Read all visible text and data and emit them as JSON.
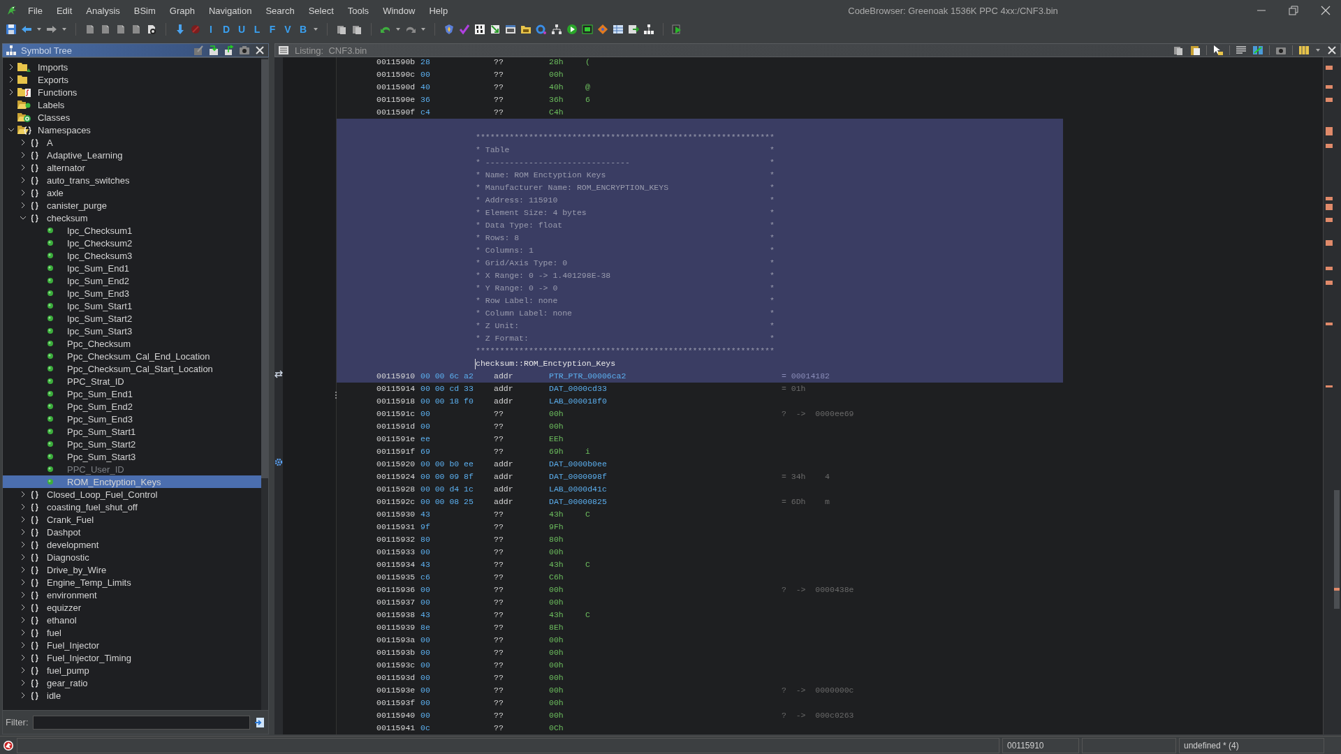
{
  "window": {
    "title": "CodeBrowser: Greenoak 1536K PPC 4xx:/CNF3.bin"
  },
  "menu": [
    "File",
    "Edit",
    "Analysis",
    "BSim",
    "Graph",
    "Navigation",
    "Search",
    "Select",
    "Tools",
    "Window",
    "Help"
  ],
  "toolbar": {
    "letter_buttons": [
      "I",
      "D",
      "U",
      "L",
      "F",
      "V",
      "B"
    ]
  },
  "symbol_tree": {
    "title": "Symbol Tree",
    "items": [
      {
        "label": "Imports",
        "kind": "imports",
        "expanded": false,
        "selected": false
      },
      {
        "label": "Exports",
        "kind": "exports",
        "expanded": false,
        "selected": false
      },
      {
        "label": "Functions",
        "kind": "functions",
        "expanded": false,
        "selected": false
      },
      {
        "label": "Labels",
        "kind": "labels",
        "selected": false
      },
      {
        "label": "Classes",
        "kind": "classes",
        "selected": false
      },
      {
        "label": "Namespaces",
        "kind": "namespaces",
        "expanded": true,
        "selected": false,
        "children": [
          {
            "label": "A",
            "kind": "namespace",
            "expanded": false,
            "selected": false
          },
          {
            "label": "Adaptive_Learning",
            "kind": "namespace",
            "expanded": false,
            "selected": false
          },
          {
            "label": "alternator",
            "kind": "namespace",
            "expanded": false,
            "selected": false
          },
          {
            "label": "auto_trans_switches",
            "kind": "namespace",
            "expanded": false,
            "selected": false
          },
          {
            "label": "axle",
            "kind": "namespace",
            "expanded": false,
            "selected": false
          },
          {
            "label": "canister_purge",
            "kind": "namespace",
            "expanded": false,
            "selected": false
          },
          {
            "label": "checksum",
            "kind": "namespace",
            "expanded": true,
            "selected": false,
            "children": [
              {
                "label": "Ipc_Checksum1",
                "kind": "label",
                "dimmed": false,
                "selected": false
              },
              {
                "label": "Ipc_Checksum2",
                "kind": "label",
                "dimmed": false,
                "selected": false
              },
              {
                "label": "Ipc_Checksum3",
                "kind": "label",
                "dimmed": false,
                "selected": false
              },
              {
                "label": "Ipc_Sum_End1",
                "kind": "label",
                "dimmed": false,
                "selected": false
              },
              {
                "label": "Ipc_Sum_End2",
                "kind": "label",
                "dimmed": false,
                "selected": false
              },
              {
                "label": "Ipc_Sum_End3",
                "kind": "label",
                "dimmed": false,
                "selected": false
              },
              {
                "label": "Ipc_Sum_Start1",
                "kind": "label",
                "dimmed": false,
                "selected": false
              },
              {
                "label": "Ipc_Sum_Start2",
                "kind": "label",
                "dimmed": false,
                "selected": false
              },
              {
                "label": "Ipc_Sum_Start3",
                "kind": "label",
                "dimmed": false,
                "selected": false
              },
              {
                "label": "Ppc_Checksum",
                "kind": "label",
                "dimmed": false,
                "selected": false
              },
              {
                "label": "Ppc_Checksum_Cal_End_Location",
                "kind": "label",
                "dimmed": false,
                "selected": false
              },
              {
                "label": "Ppc_Checksum_Cal_Start_Location",
                "kind": "label",
                "dimmed": false,
                "selected": false
              },
              {
                "label": "PPC_Strat_ID",
                "kind": "label",
                "dimmed": false,
                "selected": false
              },
              {
                "label": "Ppc_Sum_End1",
                "kind": "label",
                "dimmed": false,
                "selected": false
              },
              {
                "label": "Ppc_Sum_End2",
                "kind": "label",
                "dimmed": false,
                "selected": false
              },
              {
                "label": "Ppc_Sum_End3",
                "kind": "label",
                "dimmed": false,
                "selected": false
              },
              {
                "label": "Ppc_Sum_Start1",
                "kind": "label",
                "dimmed": false,
                "selected": false
              },
              {
                "label": "Ppc_Sum_Start2",
                "kind": "label",
                "dimmed": false,
                "selected": false
              },
              {
                "label": "Ppc_Sum_Start3",
                "kind": "label",
                "dimmed": false,
                "selected": false
              },
              {
                "label": "PPC_User_ID",
                "kind": "label",
                "dimmed": true,
                "selected": false
              },
              {
                "label": "ROM_Enctyption_Keys",
                "kind": "label",
                "dimmed": false,
                "selected": true
              }
            ]
          },
          {
            "label": "Closed_Loop_Fuel_Control",
            "kind": "namespace",
            "expanded": false,
            "selected": false
          },
          {
            "label": "coasting_fuel_shut_off",
            "kind": "namespace",
            "expanded": false,
            "selected": false
          },
          {
            "label": "Crank_Fuel",
            "kind": "namespace",
            "expanded": false,
            "selected": false
          },
          {
            "label": "Dashpot",
            "kind": "namespace",
            "expanded": false,
            "selected": false
          },
          {
            "label": "development",
            "kind": "namespace",
            "expanded": false,
            "selected": false
          },
          {
            "label": "Diagnostic",
            "kind": "namespace",
            "expanded": false,
            "selected": false
          },
          {
            "label": "Drive_by_Wire",
            "kind": "namespace",
            "expanded": false,
            "selected": false
          },
          {
            "label": "Engine_Temp_Limits",
            "kind": "namespace",
            "expanded": false,
            "selected": false
          },
          {
            "label": "environment",
            "kind": "namespace",
            "expanded": false,
            "selected": false
          },
          {
            "label": "equizzer",
            "kind": "namespace",
            "expanded": false,
            "selected": false
          },
          {
            "label": "ethanol",
            "kind": "namespace",
            "expanded": false,
            "selected": false
          },
          {
            "label": "fuel",
            "kind": "namespace",
            "expanded": false,
            "selected": false
          },
          {
            "label": "Fuel_Injector",
            "kind": "namespace",
            "expanded": false,
            "selected": false
          },
          {
            "label": "Fuel_Injector_Timing",
            "kind": "namespace",
            "expanded": false,
            "selected": false
          },
          {
            "label": "fuel_pump",
            "kind": "namespace",
            "expanded": false,
            "selected": false
          },
          {
            "label": "gear_ratio",
            "kind": "namespace",
            "expanded": false,
            "selected": false
          },
          {
            "label": "idle",
            "kind": "namespace",
            "expanded": false,
            "selected": false
          }
        ]
      }
    ],
    "filter": {
      "label": "Filter:"
    }
  },
  "listing": {
    "title": "Listing:  CNF3.bin",
    "rows": [
      {
        "kind": "code",
        "address": "0011590b",
        "bytes": "28",
        "mnemonic": "??",
        "operand": "28h",
        "reference": false,
        "char": "(",
        "selected": false
      },
      {
        "kind": "code",
        "address": "0011590c",
        "bytes": "00",
        "mnemonic": "??",
        "operand": "00h",
        "reference": false,
        "selected": false
      },
      {
        "kind": "code",
        "address": "0011590d",
        "bytes": "40",
        "mnemonic": "??",
        "operand": "40h",
        "reference": false,
        "char": "@",
        "selected": false
      },
      {
        "kind": "code",
        "address": "0011590e",
        "bytes": "36",
        "mnemonic": "??",
        "operand": "36h",
        "reference": false,
        "char": "6",
        "selected": false
      },
      {
        "kind": "code",
        "address": "0011590f",
        "bytes": "c4",
        "mnemonic": "??",
        "operand": "C4h",
        "reference": false,
        "selected": false
      },
      {
        "kind": "plate",
        "selected": true,
        "lines": [
          {
            "text": "**************************************************************"
          },
          {
            "text": "* Table",
            "end": "*"
          },
          {
            "text": "* ------------------------------",
            "end": "*"
          },
          {
            "text": "* Name: ROM Enctyption Keys",
            "end": "*"
          },
          {
            "text": "* Manufacturer Name: ROM_ENCRYPTION_KEYS",
            "end": "*"
          },
          {
            "text": "* Address: 115910",
            "end": "*"
          },
          {
            "text": "* Element Size: 4 bytes",
            "end": "*"
          },
          {
            "text": "* Data Type: float",
            "end": "*"
          },
          {
            "text": "* Rows: 8",
            "end": "*"
          },
          {
            "text": "* Columns: 1",
            "end": "*"
          },
          {
            "text": "* Grid/Axis Type: 0",
            "end": "*"
          },
          {
            "text": "* X Range: 0 -> 1.401298E-38",
            "end": "*"
          },
          {
            "text": "* Y Range: 0 -> 0",
            "end": "*"
          },
          {
            "text": "* Row Label: none",
            "end": "*"
          },
          {
            "text": "* Column Label: none",
            "end": "*"
          },
          {
            "text": "* Z Unit:",
            "end": "*"
          },
          {
            "text": "* Z Format:",
            "end": "*"
          },
          {
            "text": "**************************************************************"
          }
        ]
      },
      {
        "kind": "label",
        "text": "checksum::ROM_Enctyption_Keys",
        "selected": true
      },
      {
        "kind": "code",
        "address": "00115910",
        "bytes": "00 00 6c a2",
        "mnemonic": "addr",
        "operand": "PTR_PTR_00006ca2",
        "reference": true,
        "comment": "= 00014182",
        "selected": true
      },
      {
        "kind": "code",
        "address": "00115914",
        "bytes": "00 00 cd 33",
        "mnemonic": "addr",
        "operand": "DAT_0000cd33",
        "reference": true,
        "comment": "= 01h",
        "selected": false
      },
      {
        "kind": "code",
        "address": "00115918",
        "bytes": "00 00 18 f0",
        "mnemonic": "addr",
        "operand": "LAB_000018f0",
        "reference": true,
        "selected": false
      },
      {
        "kind": "code",
        "address": "0011591c",
        "bytes": "00",
        "mnemonic": "??",
        "operand": "00h",
        "reference": false,
        "comment": "?  ->  0000ee69",
        "selected": false
      },
      {
        "kind": "code",
        "address": "0011591d",
        "bytes": "00",
        "mnemonic": "??",
        "operand": "00h",
        "reference": false,
        "selected": false
      },
      {
        "kind": "code",
        "address": "0011591e",
        "bytes": "ee",
        "mnemonic": "??",
        "operand": "EEh",
        "reference": false,
        "selected": false
      },
      {
        "kind": "code",
        "address": "0011591f",
        "bytes": "69",
        "mnemonic": "??",
        "operand": "69h",
        "reference": false,
        "char": "i",
        "selected": false
      },
      {
        "kind": "code",
        "address": "00115920",
        "bytes": "00 00 b0 ee",
        "mnemonic": "addr",
        "operand": "DAT_0000b0ee",
        "reference": true,
        "selected": false
      },
      {
        "kind": "code",
        "address": "00115924",
        "bytes": "00 00 09 8f",
        "mnemonic": "addr",
        "operand": "DAT_0000098f",
        "reference": true,
        "comment": "= 34h    4",
        "selected": false
      },
      {
        "kind": "code",
        "address": "00115928",
        "bytes": "00 00 d4 1c",
        "mnemonic": "addr",
        "operand": "LAB_0000d41c",
        "reference": true,
        "selected": false
      },
      {
        "kind": "code",
        "address": "0011592c",
        "bytes": "00 00 08 25",
        "mnemonic": "addr",
        "operand": "DAT_00000825",
        "reference": true,
        "comment": "= 6Dh    m",
        "selected": false
      },
      {
        "kind": "code",
        "address": "00115930",
        "bytes": "43",
        "mnemonic": "??",
        "operand": "43h",
        "reference": false,
        "char": "C",
        "selected": false
      },
      {
        "kind": "code",
        "address": "00115931",
        "bytes": "9f",
        "mnemonic": "??",
        "operand": "9Fh",
        "reference": false,
        "selected": false
      },
      {
        "kind": "code",
        "address": "00115932",
        "bytes": "80",
        "mnemonic": "??",
        "operand": "80h",
        "reference": false,
        "selected": false
      },
      {
        "kind": "code",
        "address": "00115933",
        "bytes": "00",
        "mnemonic": "??",
        "operand": "00h",
        "reference": false,
        "selected": false
      },
      {
        "kind": "code",
        "address": "00115934",
        "bytes": "43",
        "mnemonic": "??",
        "operand": "43h",
        "reference": false,
        "char": "C",
        "selected": false
      },
      {
        "kind": "code",
        "address": "00115935",
        "bytes": "c6",
        "mnemonic": "??",
        "operand": "C6h",
        "reference": false,
        "selected": false
      },
      {
        "kind": "code",
        "address": "00115936",
        "bytes": "00",
        "mnemonic": "??",
        "operand": "00h",
        "reference": false,
        "comment": "?  ->  0000438e",
        "selected": false
      },
      {
        "kind": "code",
        "address": "00115937",
        "bytes": "00",
        "mnemonic": "??",
        "operand": "00h",
        "reference": false,
        "selected": false
      },
      {
        "kind": "code",
        "address": "00115938",
        "bytes": "43",
        "mnemonic": "??",
        "operand": "43h",
        "reference": false,
        "char": "C",
        "selected": false
      },
      {
        "kind": "code",
        "address": "00115939",
        "bytes": "8e",
        "mnemonic": "??",
        "operand": "8Eh",
        "reference": false,
        "selected": false
      },
      {
        "kind": "code",
        "address": "0011593a",
        "bytes": "00",
        "mnemonic": "??",
        "operand": "00h",
        "reference": false,
        "selected": false
      },
      {
        "kind": "code",
        "address": "0011593b",
        "bytes": "00",
        "mnemonic": "??",
        "operand": "00h",
        "reference": false,
        "selected": false
      },
      {
        "kind": "code",
        "address": "0011593c",
        "bytes": "00",
        "mnemonic": "??",
        "operand": "00h",
        "reference": false,
        "selected": false
      },
      {
        "kind": "code",
        "address": "0011593d",
        "bytes": "00",
        "mnemonic": "??",
        "operand": "00h",
        "reference": false,
        "selected": false
      },
      {
        "kind": "code",
        "address": "0011593e",
        "bytes": "00",
        "mnemonic": "??",
        "operand": "00h",
        "reference": false,
        "comment": "?  ->  0000000c",
        "selected": false
      },
      {
        "kind": "code",
        "address": "0011593f",
        "bytes": "00",
        "mnemonic": "??",
        "operand": "00h",
        "reference": false,
        "selected": false
      },
      {
        "kind": "code",
        "address": "00115940",
        "bytes": "00",
        "mnemonic": "??",
        "operand": "00h",
        "reference": false,
        "comment": "?  ->  000c0263",
        "selected": false
      },
      {
        "kind": "code",
        "address": "00115941",
        "bytes": "0c",
        "mnemonic": "??",
        "operand": "0Ch",
        "reference": false,
        "selected": false
      }
    ]
  },
  "status_bar": {
    "address": "00115910",
    "data_type": "undefined * (4)"
  }
}
